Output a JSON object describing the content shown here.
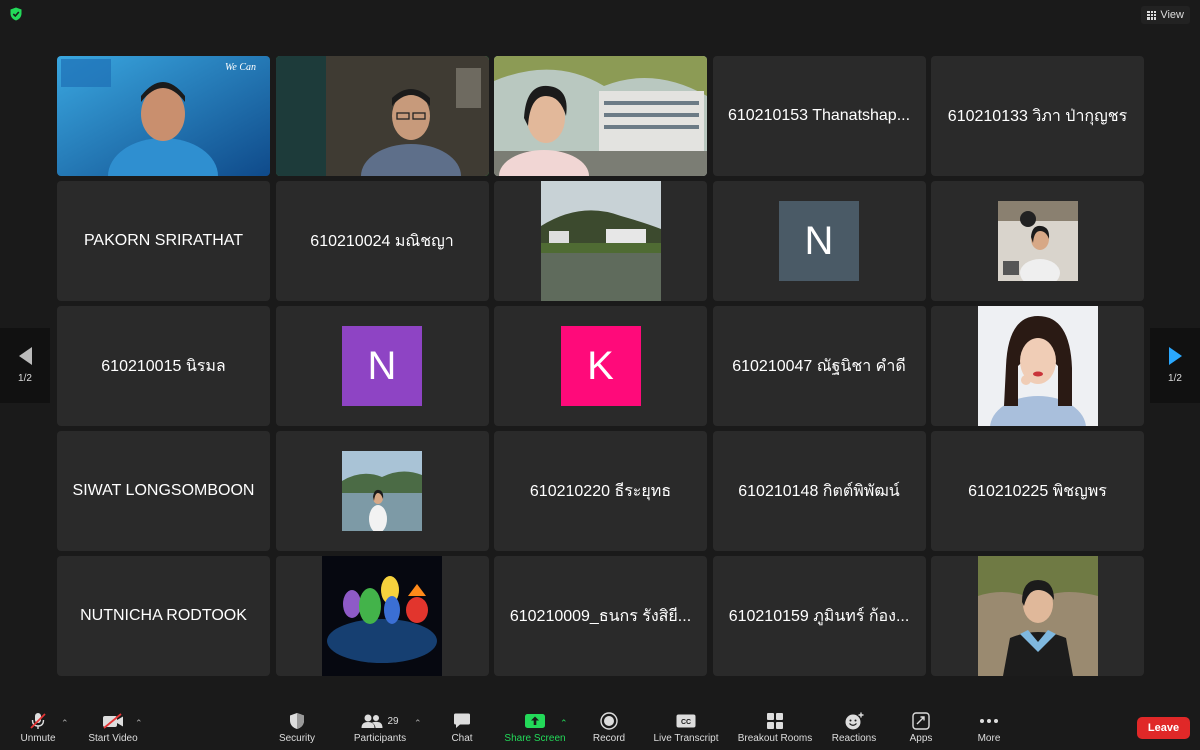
{
  "window": {
    "view_label": "View"
  },
  "gallery": {
    "tiles": [
      {
        "name": "",
        "type": "video"
      },
      {
        "name": "",
        "type": "video"
      },
      {
        "name": "",
        "type": "video"
      },
      {
        "name": "610210153 Thanatshap...",
        "type": "name"
      },
      {
        "name": "610210133 วิภา ป่ากุญชร",
        "type": "name"
      },
      {
        "name": "PAKORN SRIRATHAT",
        "type": "name"
      },
      {
        "name": "610210024 มณิชญา",
        "type": "name"
      },
      {
        "name": "",
        "type": "photo"
      },
      {
        "name": "",
        "type": "initial",
        "initial": "N",
        "color": "#4a5a66"
      },
      {
        "name": "",
        "type": "photo"
      },
      {
        "name": "610210015 นิรมล",
        "type": "name"
      },
      {
        "name": "",
        "type": "initial",
        "initial": "N",
        "color": "#8e44c4"
      },
      {
        "name": "",
        "type": "initial",
        "initial": "K",
        "color": "#ff0a7a"
      },
      {
        "name": "610210047 ณัฐนิชา คำดี",
        "type": "name"
      },
      {
        "name": "",
        "type": "photo"
      },
      {
        "name": "SIWAT LONGSOMBOON",
        "type": "name"
      },
      {
        "name": "",
        "type": "photo"
      },
      {
        "name": "610210220 ธีระยุทธ",
        "type": "name"
      },
      {
        "name": "610210148 กิตต์พิพัฒน์",
        "type": "name"
      },
      {
        "name": "610210225 พิชญพร",
        "type": "name"
      },
      {
        "name": "NUTNICHA RODTOOK",
        "type": "name"
      },
      {
        "name": "",
        "type": "photo"
      },
      {
        "name": "610210009_ธนกร รังสิยี...",
        "type": "name"
      },
      {
        "name": "610210159 ภูมินทร์ ก้อง...",
        "type": "name"
      },
      {
        "name": "",
        "type": "photo"
      }
    ],
    "page_indicator_left": "1/2",
    "page_indicator_right": "1/2"
  },
  "toolbar": {
    "unmute": "Unmute",
    "start_video": "Start Video",
    "security": "Security",
    "participants": "Participants",
    "participants_count": "29",
    "chat": "Chat",
    "share_screen": "Share Screen",
    "record": "Record",
    "live_transcript": "Live Transcript",
    "breakout_rooms": "Breakout Rooms",
    "reactions": "Reactions",
    "apps": "Apps",
    "more": "More",
    "leave": "Leave"
  },
  "colors": {
    "accent_green": "#23d959",
    "leave_red": "#e02828",
    "nav_blue": "#2aa8ff"
  }
}
